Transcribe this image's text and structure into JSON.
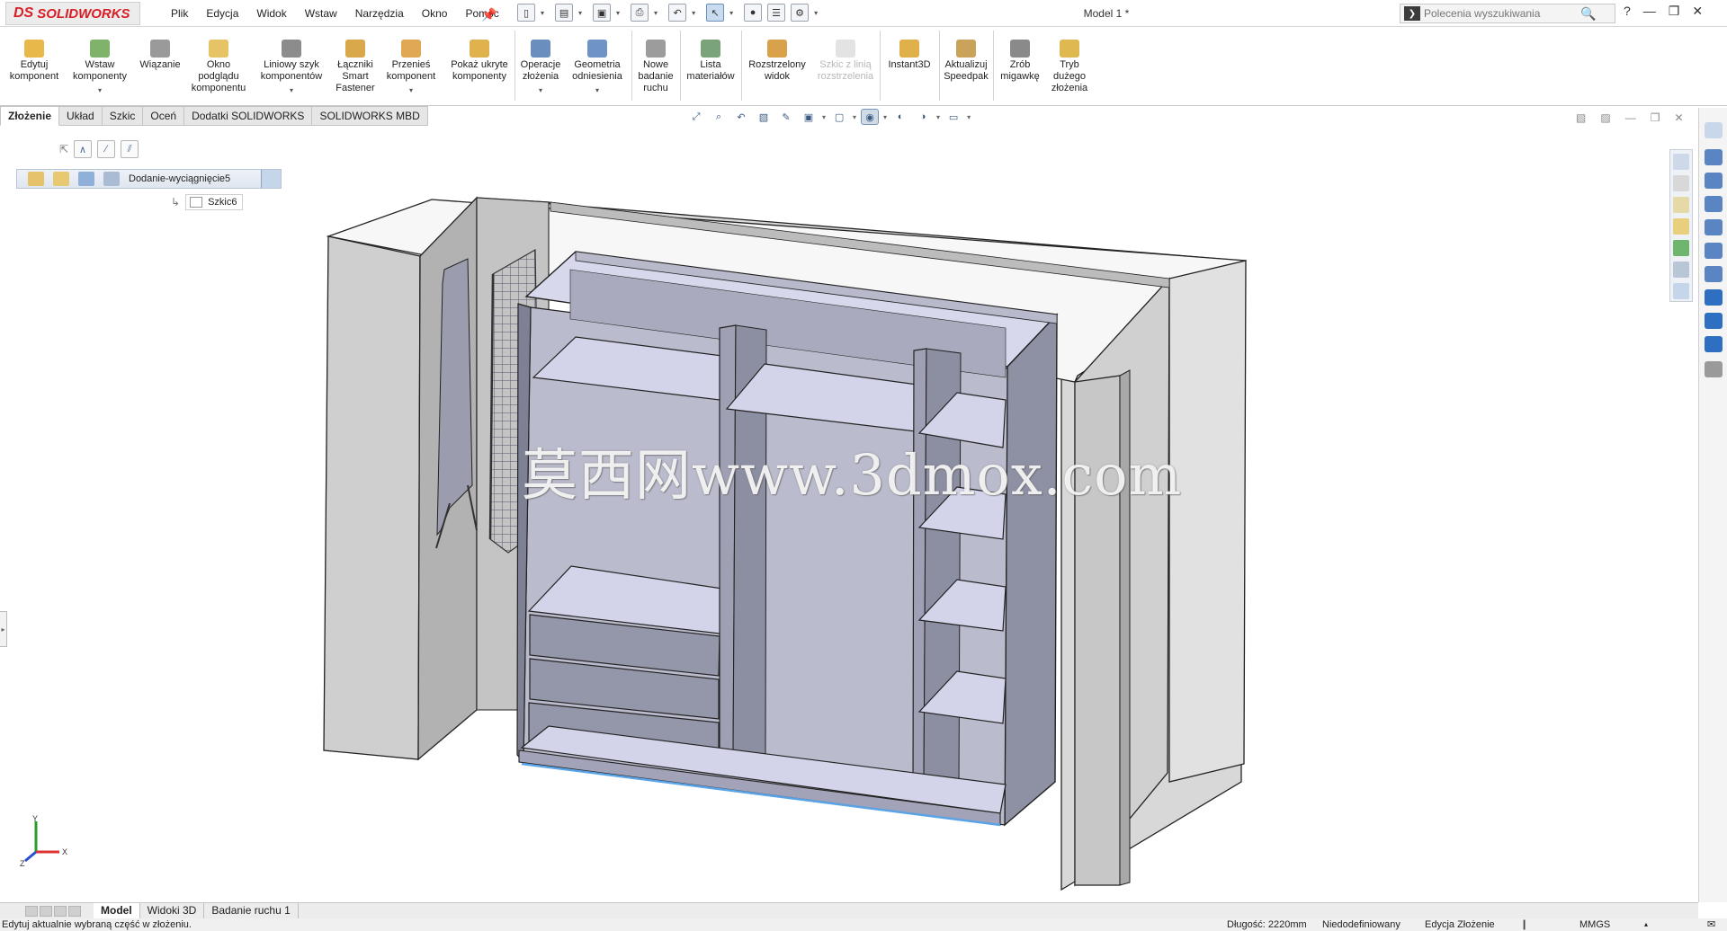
{
  "app": {
    "brand_ds": "DS",
    "brand_name": "SOLIDWORKS",
    "document_title": "Model 1 *"
  },
  "menus": [
    "Plik",
    "Edycja",
    "Widok",
    "Wstaw",
    "Narzędzia",
    "Okno",
    "Pomoc"
  ],
  "search": {
    "placeholder": "Polecenia wyszukiwania"
  },
  "ribbon": [
    {
      "label": "Edytuj\nkomponent",
      "icon": "edit-component-icon"
    },
    {
      "label": "Wstaw\nkomponenty",
      "icon": "insert-components-icon",
      "dropdown": true
    },
    {
      "label": "Wiązanie",
      "icon": "mate-icon"
    },
    {
      "label": "Okno\npodglądu\nkomponentu",
      "icon": "component-preview-icon"
    },
    {
      "label": "Liniowy szyk\nkomponentów",
      "icon": "linear-pattern-icon",
      "dropdown": true
    },
    {
      "label": "Łączniki\nSmart\nFastener",
      "icon": "smart-fastener-icon"
    },
    {
      "label": "Przenieś\nkomponent",
      "icon": "move-component-icon",
      "dropdown": true
    },
    {
      "label": "Pokaż ukryte\nkomponenty",
      "icon": "show-hidden-icon"
    },
    {
      "label": "Operacje\nzłożenia",
      "icon": "assembly-features-icon",
      "dropdown": true
    },
    {
      "label": "Geometria\nodniesienia",
      "icon": "reference-geometry-icon",
      "dropdown": true
    },
    {
      "label": "Nowe\nbadanie\nruchu",
      "icon": "motion-study-icon"
    },
    {
      "label": "Lista\nmateriałów",
      "icon": "bill-of-materials-icon"
    },
    {
      "label": "Rozstrzelony\nwidok",
      "icon": "exploded-view-icon"
    },
    {
      "label": "Szkic z linią\nrozstrzelenia",
      "icon": "explode-line-sketch-icon",
      "disabled": true
    },
    {
      "label": "Instant3D",
      "icon": "instant3d-icon"
    },
    {
      "label": "Aktualizuj\nSpeedpak",
      "icon": "speedpak-icon"
    },
    {
      "label": "Zrób\nmigawkę",
      "icon": "snapshot-icon"
    },
    {
      "label": "Tryb\ndużego\nzłożenia",
      "icon": "large-assembly-icon"
    }
  ],
  "tabs": [
    "Złożenie",
    "Układ",
    "Szkic",
    "Oceń",
    "Dodatki SOLIDWORKS",
    "SOLIDWORKS MBD"
  ],
  "active_tab": "Złożenie",
  "tree": {
    "breadcrumb_label": "Dodanie-wyciągnięcie5",
    "sketch_label": "Szkic6"
  },
  "watermark": "莫西网www.3dmox.com",
  "triad": {
    "x": "X",
    "y": "Y",
    "z": "Z"
  },
  "bottom_tabs": [
    "Model",
    "Widoki 3D",
    "Badanie ruchu 1"
  ],
  "active_bottom_tab": "Model",
  "status": {
    "message": "Edytuj aktualnie wybraną część w złożeniu.",
    "length": "Długość: 2220mm",
    "definition": "Niedodefiniowany",
    "mode": "Edycja Złożenie",
    "units": "MMGS"
  },
  "colors": {
    "brand_red": "#d81e26",
    "panel_face": "#c7c8dc",
    "panel_side": "#8d8fa3",
    "wall": "#d9d9d9",
    "selection_blue": "#5aa3e6"
  }
}
